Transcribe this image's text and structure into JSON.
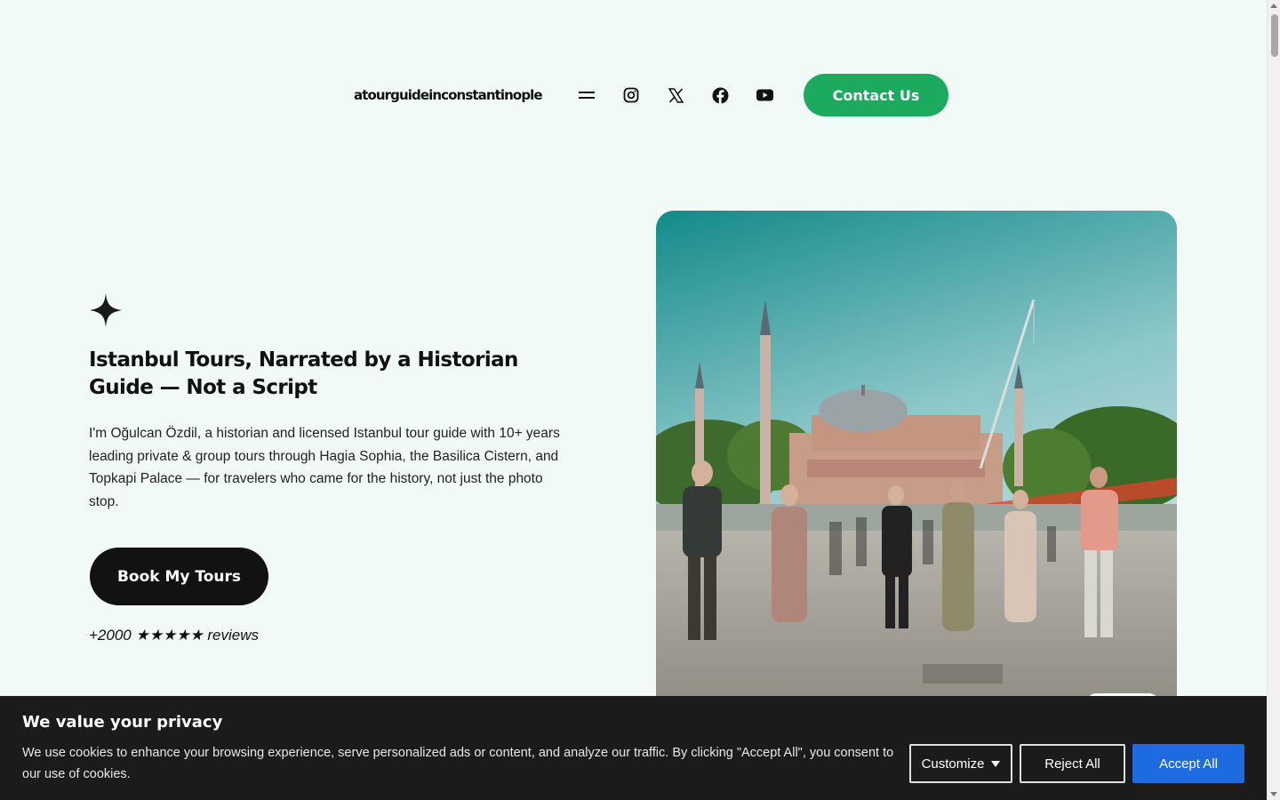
{
  "header": {
    "logo_text": "atourguideinconstantinople",
    "contact_label": "Contact Us",
    "icons": [
      "menu-icon",
      "instagram-icon",
      "x-icon",
      "facebook-icon",
      "youtube-icon"
    ]
  },
  "hero": {
    "title": "Istanbul Tours, Narrated by a Historian Guide — Not a Script",
    "description": "I'm Oğulcan Özdil, a historian and licensed Istanbul tour guide with 10+ years leading private & group tours through Hagia Sophia, the Basilica Cistern, and Topkapi Palace — for travelers who came for the history, not just the photo stop.",
    "cta_label": "Book My Tours",
    "reviews": "+2000 ★★★★★ reviews",
    "image_icon": "hagia-sophia-tour-group-photo"
  },
  "cookie_banner": {
    "title": "We value your privacy",
    "text": "We use cookies to enhance your browsing experience, serve personalized ads or content, and analyze our traffic. By clicking \"Accept All\", you consent to our use of cookies.",
    "customize_label": "Customize",
    "reject_label": "Reject All",
    "accept_label": "Accept All"
  },
  "colors": {
    "background": "#f1faf7",
    "contact_button": "#1cab5e",
    "book_button": "#121212",
    "accept_button": "#1e6ae0",
    "banner": "#1b1b1b"
  }
}
